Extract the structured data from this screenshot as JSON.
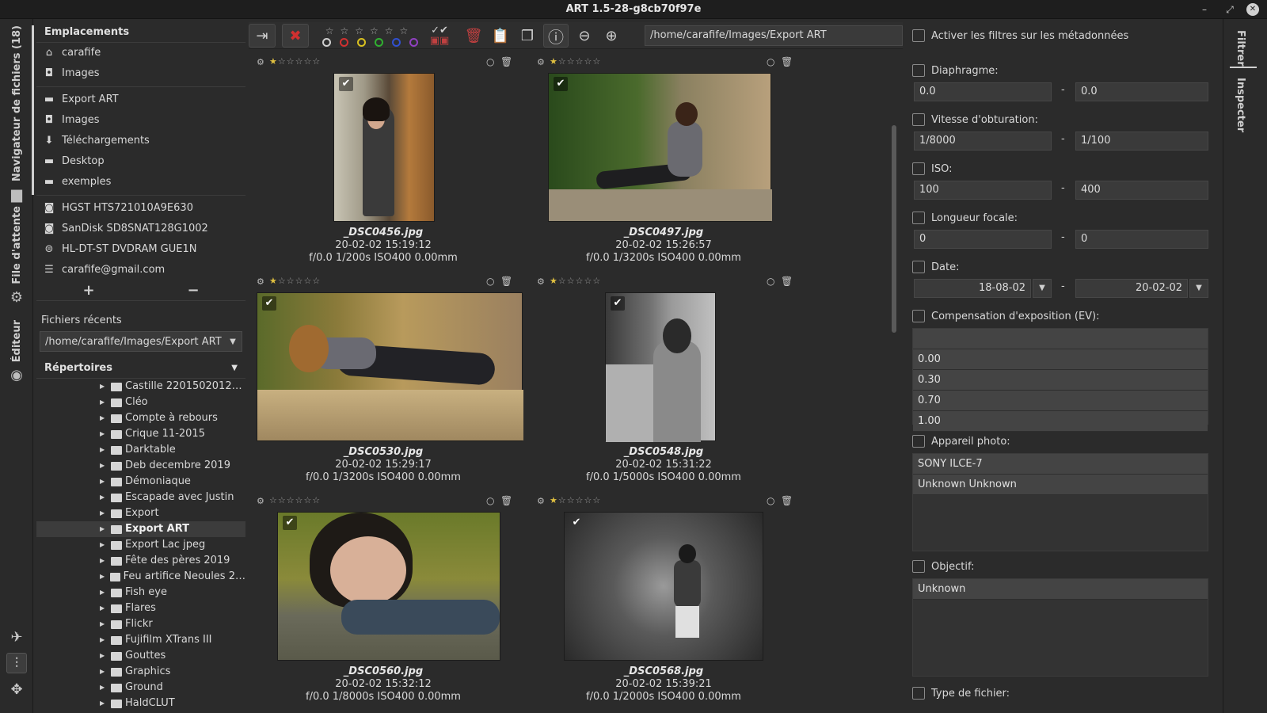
{
  "window": {
    "title": "ART 1.5-28-g8cb70f97e",
    "minimize": "–",
    "restore": "⤢",
    "close": "✕"
  },
  "vtabs": {
    "navigator": "Navigateur de fichiers (18)",
    "queue": "File d'attente",
    "editor": "Éditeur"
  },
  "places": {
    "header": "Emplacements",
    "group1": [
      {
        "label": "carafife",
        "icon": "home-icon"
      },
      {
        "label": "Images",
        "icon": "camera-icon"
      }
    ],
    "group2": [
      {
        "label": "Export ART",
        "icon": "folder-icon"
      },
      {
        "label": "Images",
        "icon": "camera-icon"
      },
      {
        "label": "Téléchargements",
        "icon": "download-icon"
      },
      {
        "label": "Desktop",
        "icon": "folder-icon"
      },
      {
        "label": "exemples",
        "icon": "folder-icon"
      }
    ],
    "group3": [
      {
        "label": "HGST HTS721010A9E630",
        "icon": "drive-icon"
      },
      {
        "label": "SanDisk SD8SNAT128G1002",
        "icon": "drive-icon"
      },
      {
        "label": "HL-DT-ST DVDRAM GUE1N",
        "icon": "optical-drive-icon"
      },
      {
        "label": "carafife@gmail.com",
        "icon": "network-icon"
      }
    ],
    "add": "+",
    "remove": "−"
  },
  "recent": {
    "header": "Fichiers récents",
    "value": "/home/carafife/Images/Export ART"
  },
  "dirs": {
    "header": "Répertoires",
    "items": [
      {
        "label": "Castille 2201502012…",
        "selected": false
      },
      {
        "label": "Cléo",
        "selected": false
      },
      {
        "label": "Compte à rebours",
        "selected": false
      },
      {
        "label": "Crique 11-2015",
        "selected": false
      },
      {
        "label": "Darktable",
        "selected": false
      },
      {
        "label": "Deb decembre 2019",
        "selected": false
      },
      {
        "label": "Démoniaque",
        "selected": false
      },
      {
        "label": "Escapade avec Justin",
        "selected": false
      },
      {
        "label": "Export",
        "selected": false
      },
      {
        "label": "Export ART",
        "selected": true
      },
      {
        "label": "Export Lac jpeg",
        "selected": false
      },
      {
        "label": "Fête des pères 2019",
        "selected": false
      },
      {
        "label": "Feu artifice Neoules 2…",
        "selected": false
      },
      {
        "label": "Fish eye",
        "selected": false
      },
      {
        "label": "Flares",
        "selected": false
      },
      {
        "label": "Flickr",
        "selected": false
      },
      {
        "label": "Fujifilm XTrans III",
        "selected": false
      },
      {
        "label": "Gouttes",
        "selected": false
      },
      {
        "label": "Graphics",
        "selected": false
      },
      {
        "label": "Ground",
        "selected": false
      },
      {
        "label": "HaldCLUT",
        "selected": false
      }
    ]
  },
  "toolbar": {
    "path": "/home/carafife/Images/Export ART",
    "color_labels": [
      "#cfcfcf",
      "#d03030",
      "#d8c020",
      "#30b030",
      "#3050d0",
      "#9040c0"
    ]
  },
  "thumbs": [
    {
      "name": "_DSC0456.jpg",
      "date": "20-02-02 15:19:12",
      "info": "f/0.0 1/200s ISO400 0.00mm",
      "rating": 1
    },
    {
      "name": "_DSC0497.jpg",
      "date": "20-02-02 15:26:57",
      "info": "f/0.0 1/3200s ISO400 0.00mm",
      "rating": 1
    },
    {
      "name": "_DSC0530.jpg",
      "date": "20-02-02 15:29:17",
      "info": "f/0.0 1/3200s ISO400 0.00mm",
      "rating": 1
    },
    {
      "name": "_DSC0548.jpg",
      "date": "20-02-02 15:31:22",
      "info": "f/0.0 1/5000s ISO400 0.00mm",
      "rating": 1
    },
    {
      "name": "_DSC0560.jpg",
      "date": "20-02-02 15:32:12",
      "info": "f/0.0 1/8000s ISO400 0.00mm",
      "rating": 0
    },
    {
      "name": "_DSC0568.jpg",
      "date": "20-02-02 15:39:21",
      "info": "f/0.0 1/2000s ISO400 0.00mm",
      "rating": 1
    }
  ],
  "filters": {
    "enable": "Activer les filtres sur les métadonnées",
    "aperture": {
      "label": "Diaphragme:",
      "from": "0.0",
      "to": "0.0"
    },
    "shutter": {
      "label": "Vitesse d'obturation:",
      "from": "1/8000",
      "to": "1/100"
    },
    "iso": {
      "label": "ISO:",
      "from": "100",
      "to": "400"
    },
    "focal": {
      "label": "Longueur focale:",
      "from": "0",
      "to": "0"
    },
    "date": {
      "label": "Date:",
      "from": "18-08-02",
      "to": "20-02-02"
    },
    "exposure": {
      "label": "Compensation d'exposition (EV):",
      "values": [
        "",
        "0.00",
        "0.30",
        "0.70",
        "1.00"
      ]
    },
    "camera": {
      "label": "Appareil photo:",
      "values": [
        "SONY ILCE-7",
        "Unknown Unknown"
      ]
    },
    "lens": {
      "label": "Objectif:",
      "values": [
        "Unknown"
      ]
    },
    "filetype": {
      "label": "Type de fichier:"
    },
    "dash": "-"
  },
  "rtabs": {
    "filter": "Filtrer",
    "inspector": "Inspecter"
  }
}
